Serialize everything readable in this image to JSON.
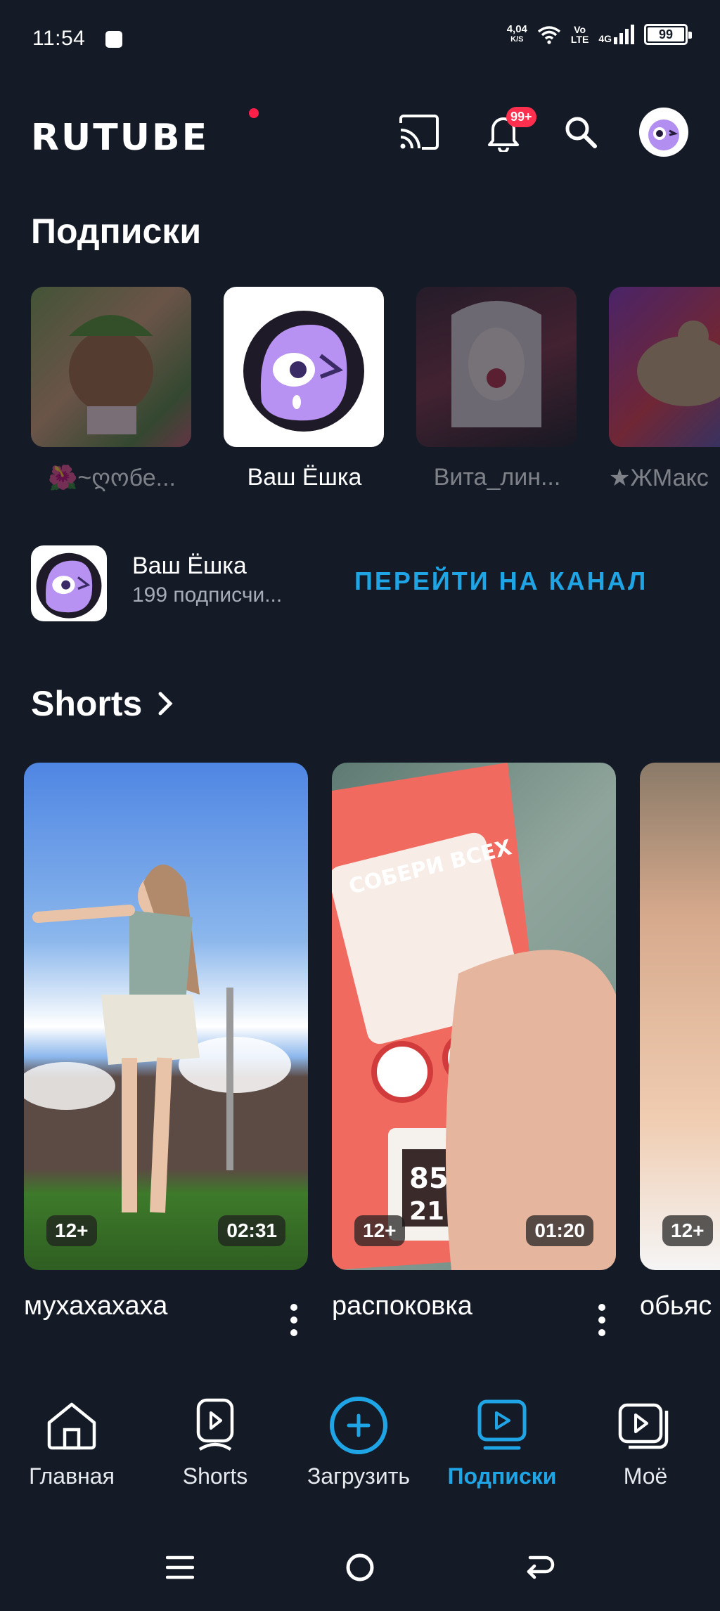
{
  "status_bar": {
    "time": "11:54",
    "net_speed_top": "4,04",
    "net_speed_unit": "K/S",
    "volte_top": "Vo",
    "volte_bottom": "LTE",
    "network": "4G",
    "battery": "99"
  },
  "header": {
    "logo": "RUTUBE",
    "notification_badge": "99+"
  },
  "subscriptions": {
    "title": "Подписки",
    "items": [
      {
        "name": "🌺~ღოбе..."
      },
      {
        "name": "Ваш Ёшка"
      },
      {
        "name": "Вита_лин..."
      },
      {
        "name": "★ЖМакс"
      }
    ]
  },
  "channel": {
    "name": "Ваш Ёшка",
    "subscribers": "199 подписчи...",
    "link": "ПЕРЕЙТИ НА КАНАЛ"
  },
  "shorts": {
    "title": "Shorts",
    "items": [
      {
        "title": "мухахахаха",
        "age": "12+",
        "duration": "02:31"
      },
      {
        "title": "распоковка",
        "age": "12+",
        "duration": "01:20"
      },
      {
        "title": "обьяс",
        "age": "12+",
        "duration": ""
      }
    ]
  },
  "bottom_nav": {
    "items": [
      {
        "label": "Главная",
        "icon": "home-icon"
      },
      {
        "label": "Shorts",
        "icon": "shorts-icon"
      },
      {
        "label": "Загрузить",
        "icon": "upload-plus-icon"
      },
      {
        "label": "Подписки",
        "icon": "subscriptions-icon"
      },
      {
        "label": "Моё",
        "icon": "library-icon"
      }
    ],
    "active_index": 3
  },
  "colors": {
    "background": "#141b26",
    "accent": "#1fa4e6",
    "badge": "#ff2f4d"
  }
}
